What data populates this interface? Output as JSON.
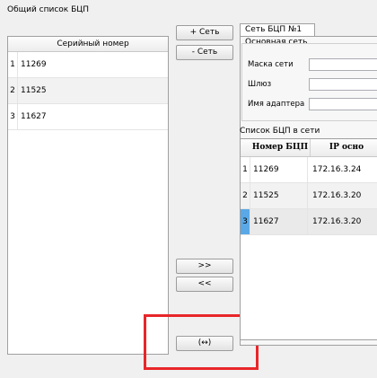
{
  "left_panel": {
    "title": "Общий список БЦП",
    "column_header": "Серийный номер",
    "rows": [
      {
        "num": "1",
        "serial": "11269"
      },
      {
        "num": "2",
        "serial": "11525"
      },
      {
        "num": "3",
        "serial": "11627"
      }
    ]
  },
  "middle_buttons": {
    "add_network": "+ Сеть",
    "remove_network": "- Сеть",
    "move_right": ">>",
    "move_left": "<<",
    "swap": "(↔)"
  },
  "network_tab": {
    "tab_label": "Сеть БЦП №1",
    "group_title": "Основная сеть",
    "fields": {
      "mask_label": "Маска сети",
      "mask_value": "",
      "gateway_label": "Шлюз",
      "gateway_value": "",
      "adapter_label": "Имя адаптера",
      "adapter_value": ""
    },
    "list_title": "Список БЦП в сети",
    "columns": [
      "Номер БЦП",
      "IP осно"
    ],
    "rows": [
      {
        "num": "1",
        "number": "11269",
        "ip": "172.16.3.24"
      },
      {
        "num": "2",
        "number": "11525",
        "ip": "172.16.3.20"
      },
      {
        "num": "3",
        "number": "11627",
        "ip": "172.16.3.20"
      }
    ],
    "selected_row_index": 3
  },
  "colors": {
    "highlight": "#e8262a",
    "selected_row_marker": "#5aa8e6"
  }
}
